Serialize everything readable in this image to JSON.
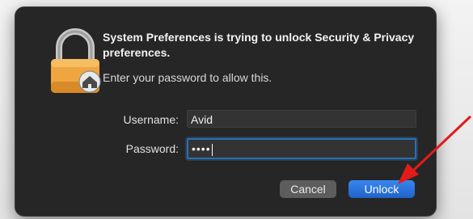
{
  "dialog": {
    "message": "System Preferences is trying to unlock Security & Privacy preferences.",
    "instruction": "Enter your password to allow this.",
    "username_label": "Username:",
    "username_value": "Avid",
    "password_label": "Password:",
    "password_value": "••••",
    "cancel_label": "Cancel",
    "unlock_label": "Unlock"
  },
  "icons": {
    "lock": "padlock-house-icon",
    "annotation": "red-arrow-icon"
  },
  "colors": {
    "dialog_bg": "#262626",
    "field_bg": "#333333",
    "focus_ring": "#2b6fb0",
    "cancel_bg": "#5d5d5d",
    "unlock_bg": "#1f63c8",
    "annotation_arrow": "#e21b1b",
    "lock_body": "#f0a640"
  }
}
